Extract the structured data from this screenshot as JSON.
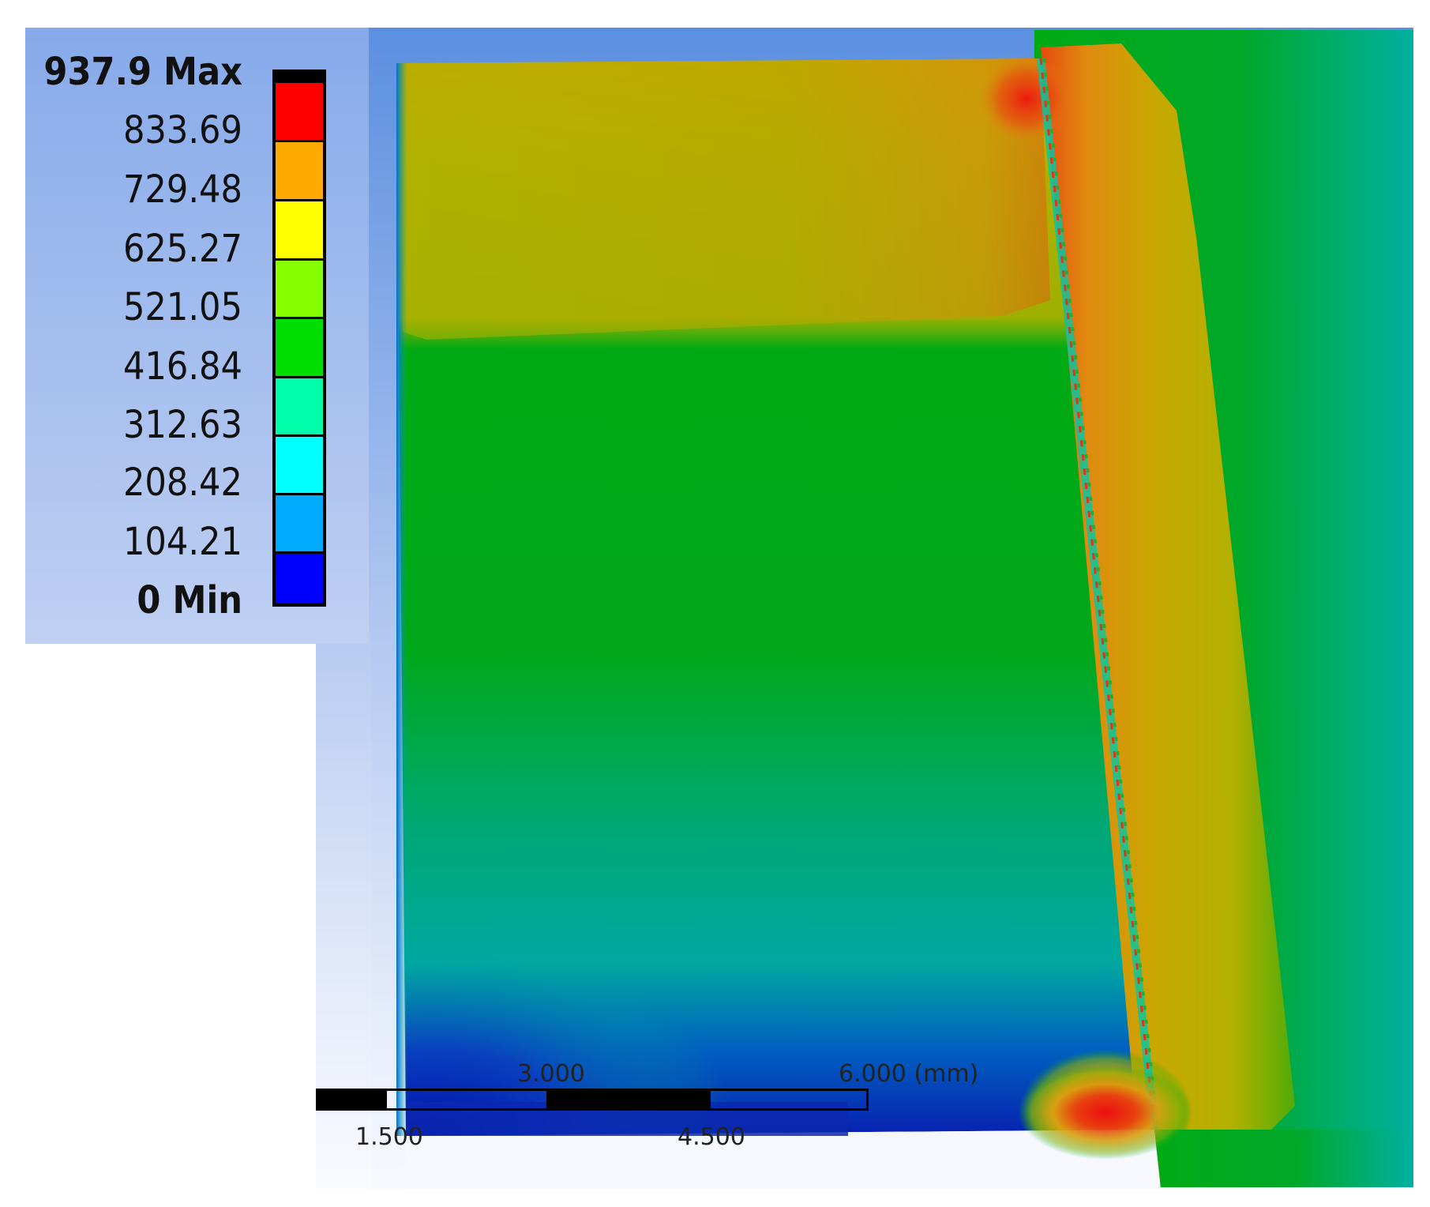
{
  "legend": {
    "max_label": "937.9 Max",
    "min_label": "0 Min",
    "levels": [
      "833.69",
      "729.48",
      "625.27",
      "521.05",
      "416.84",
      "312.63",
      "208.42",
      "104.21"
    ],
    "bands": [
      {
        "color": "#ff0000"
      },
      {
        "color": "#ffaa00"
      },
      {
        "color": "#ffff00"
      },
      {
        "color": "#88ff00"
      },
      {
        "color": "#00dd00"
      },
      {
        "color": "#00ffaa"
      },
      {
        "color": "#00ffff"
      },
      {
        "color": "#00aaff"
      },
      {
        "color": "#0000ff"
      }
    ]
  },
  "scale_bar": {
    "labels_top": [
      "3.000",
      "6.000 (mm)"
    ],
    "labels_bottom": [
      "1.500",
      "4.500"
    ]
  },
  "colors": {
    "hot": "#e8281a",
    "warm": "#d98a18",
    "mid": "#a8b400",
    "green": "#00a818",
    "teal": "#00a890",
    "cyan": "#00b8b8",
    "deep_blue": "#0a2ab8"
  }
}
